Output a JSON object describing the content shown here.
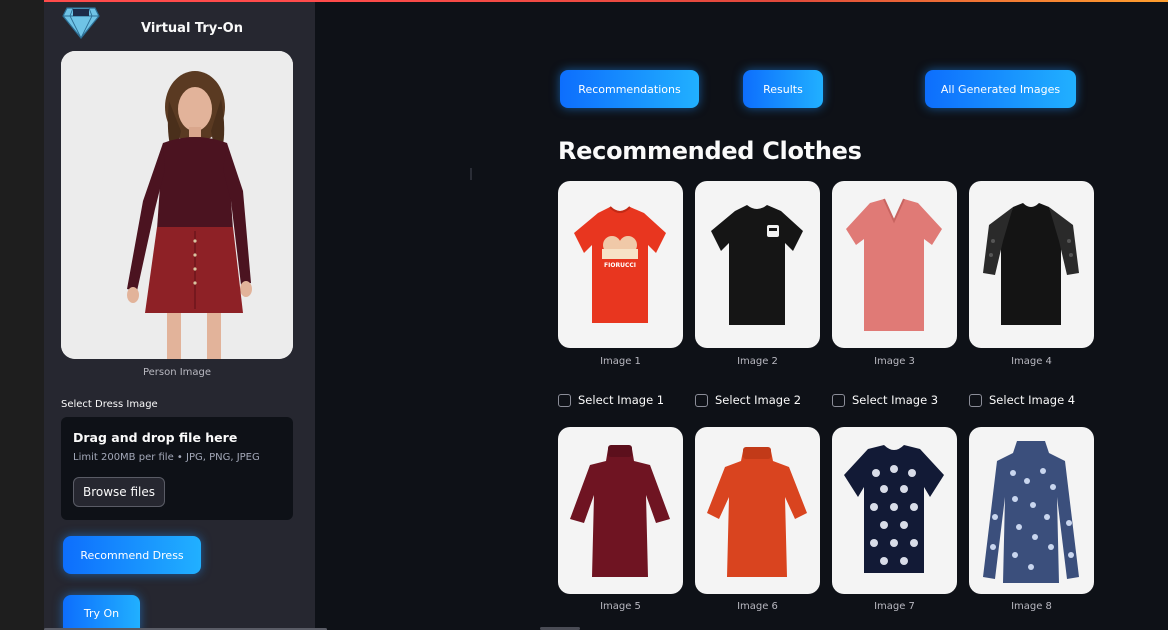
{
  "app": {
    "title": "Virtual Try-On",
    "logo_icon": "diamond-logo-icon"
  },
  "sidebar": {
    "person_caption": "Person Image",
    "dress_label": "Select Dress Image",
    "uploader": {
      "title": "Drag and drop file here",
      "limit": "Limit 200MB per file • JPG, PNG, JPEG",
      "browse_label": "Browse files"
    },
    "recommend_label": "Recommend Dress",
    "tryon_label": "Try On"
  },
  "tabs": [
    {
      "label": "Recommendations"
    },
    {
      "label": "Results"
    },
    {
      "label": "All Generated Images"
    }
  ],
  "main": {
    "section_title": "Recommended Clothes",
    "items": [
      {
        "caption": "Image 1",
        "select_label": "Select Image 1",
        "color": "#e8361f",
        "style": "crew-print",
        "print_text": "FIORUCCI"
      },
      {
        "caption": "Image 2",
        "select_label": "Select Image 2",
        "color": "#151515",
        "style": "crew-patch"
      },
      {
        "caption": "Image 3",
        "select_label": "Select Image 3",
        "color": "#e07a76",
        "style": "vneck"
      },
      {
        "caption": "Image 4",
        "select_label": "Select Image 4",
        "color": "#141414",
        "style": "lace-raglan"
      },
      {
        "caption": "Image 5",
        "color": "#6f1422",
        "style": "mock-velvet"
      },
      {
        "caption": "Image 6",
        "color": "#d9441f",
        "style": "mock-knit"
      },
      {
        "caption": "Image 7",
        "color": "#121a36",
        "style": "polka"
      },
      {
        "caption": "Image 8",
        "color": "#3b4f7c",
        "style": "longsleeve-print"
      }
    ]
  },
  "colors": {
    "background": "#0e1117",
    "sidebar": "#262730",
    "accent_button": "#0d6efd",
    "header_accent": "#ff4b4b"
  }
}
